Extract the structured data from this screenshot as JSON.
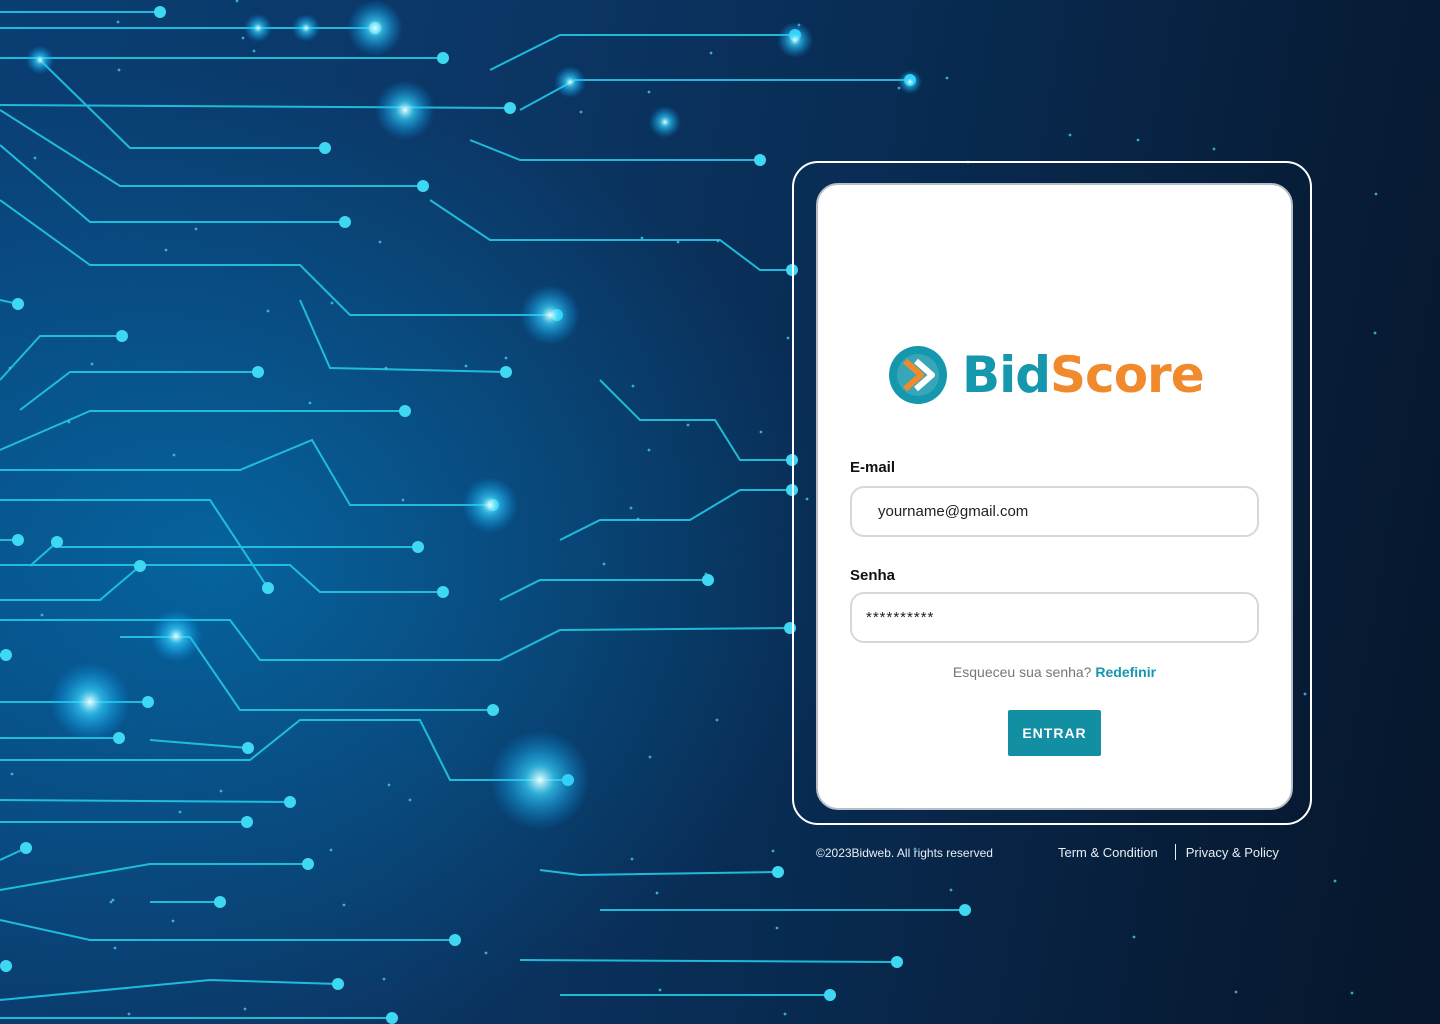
{
  "brand": {
    "name_part1": "Bid",
    "name_part2": "Score",
    "primary_color": "#1597ad",
    "accent_color": "#f08a2d",
    "logo_icon": "double-chevron-right-icon"
  },
  "form": {
    "email_label": "E-mail",
    "email_value": "yourname@gmail.com",
    "password_label": "Senha",
    "password_value": "**********",
    "forgot_text": "Esqueceu sua senha?",
    "forgot_link": "Redefinir",
    "submit_label": "ENTRAR"
  },
  "footer": {
    "copyright": "©2023Bidweb. All rights reserved",
    "terms": "Term & Condition",
    "privacy": "Privacy & Policy"
  }
}
